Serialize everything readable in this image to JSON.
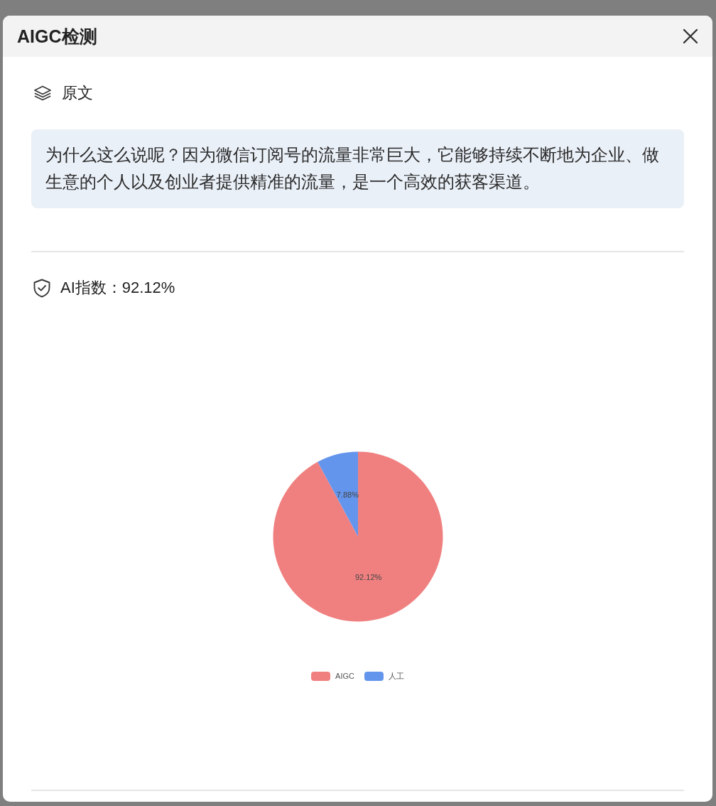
{
  "dialog": {
    "title": "AIGC检测"
  },
  "original": {
    "heading": "原文",
    "text": "为什么这么说呢？因为微信订阅号的流量非常巨大，它能够持续不断地为企业、做生意的个人以及创业者提供精准的流量，是一个高效的获客渠道。"
  },
  "ai_index": {
    "label": "AI指数：92.12%",
    "chart_data": {
      "type": "pie",
      "categories": [
        "AIGC",
        "人工"
      ],
      "values": [
        92.12,
        7.88
      ],
      "colors": [
        "#f08080",
        "#6495ed"
      ],
      "value_labels": [
        "92.12%",
        "7.88%"
      ],
      "legend": true
    }
  }
}
